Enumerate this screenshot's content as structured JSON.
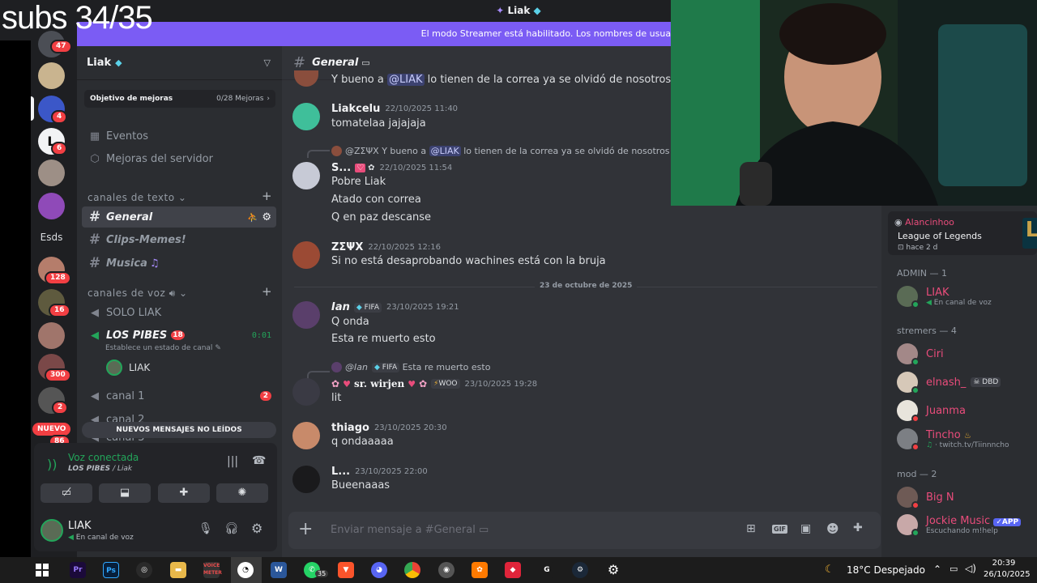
{
  "overlay": {
    "subs": "subs 34/35"
  },
  "window": {
    "title": "Liak"
  },
  "banner": {
    "text": "El modo Streamer está habilitado. Los nombres de usuario se han truncado"
  },
  "servers": {
    "esds_label": "Esds",
    "new_badge": "NUEVO",
    "badges": [
      "47",
      "4",
      "6",
      "128",
      "16",
      "300",
      "2",
      "86"
    ]
  },
  "server": {
    "name": "Liak",
    "boost": {
      "label": "Objetivo de mejoras",
      "progress": "0/28 Mejoras"
    },
    "events": "Eventos",
    "boosts": "Mejoras del servidor"
  },
  "text_category": "canales de texto",
  "text_channels": [
    {
      "name": "General"
    },
    {
      "name": "Clips-Memes!"
    },
    {
      "name": "Musica"
    }
  ],
  "voice_category": "canales de voz",
  "voice_channels": {
    "solo": "SOLO LIAK",
    "pibes": "LOS PIBES",
    "pibes_timer": "0:01",
    "status_hint": "Establece un estado de canal",
    "member": "LIAK",
    "canal1": "canal 1",
    "canal1_badge": "2",
    "canal2": "canal 2",
    "canal3": "canal 3",
    "unread": "NUEVOS MENSAJES NO LEÍDOS"
  },
  "voice_panel": {
    "title": "Voz conectada",
    "subtitle": "LOS PIBES",
    "server": "/ Liak"
  },
  "user": {
    "name": "LIAK",
    "status": "En canal de voz"
  },
  "chat": {
    "channel": "General",
    "top_partial": {
      "pre": "Y bueno a",
      "mention": "@LIAK",
      "post": "lo tienen de la correa ya se olvidó de nosotros"
    },
    "m1": {
      "author": "Liakcelu",
      "time": "22/10/2025 11:40",
      "lines": [
        "tomatelaa jajajaja"
      ]
    },
    "m2": {
      "reply_author": "@ΖΣΨΧ",
      "reply_pre": "Y bueno a",
      "reply_mention": "@LIAK",
      "reply_post": "lo tienen de la correa ya se olvidó de nosotros",
      "author": "S...",
      "time": "22/10/2025 11:54",
      "lines": [
        "Pobre Liak",
        "Atado con correa",
        "Q en paz descanse"
      ]
    },
    "m3": {
      "author": "ΖΣΨΧ",
      "time": "22/10/2025 12:16",
      "lines": [
        "Si no está desaprobando wachines está con la bruja"
      ]
    },
    "divider": "23 de octubre de 2025",
    "m4": {
      "author": "Ian",
      "tag": "FIFA",
      "time": "23/10/2025 19:21",
      "lines": [
        "Q onda",
        "Esta re muerto esto"
      ]
    },
    "m5": {
      "reply_author": "@Ian",
      "reply_tag": "FIFA",
      "reply_text": "Esta re muerto esto",
      "author": "sr. wirjen",
      "tag": "WOO",
      "time": "23/10/2025 19:28",
      "lines": [
        "lit"
      ]
    },
    "m6": {
      "author": "thiago",
      "time": "23/10/2025 20:30",
      "lines": [
        "q ondaaaaa"
      ]
    },
    "m7": {
      "author": "L...",
      "time": "23/10/2025 22:00",
      "lines": [
        "Bueenaaas"
      ]
    },
    "input_placeholder": "Enviar mensaje a #General"
  },
  "members": {
    "top": {
      "name": "Alancinhoo",
      "game": "League of Legends",
      "since": "hace 2 d"
    },
    "admin": {
      "header": "ADMIN — 1",
      "list": [
        {
          "name": "LIAK",
          "sub": "En canal de voz"
        }
      ]
    },
    "streamers": {
      "header": "stremers — 4",
      "list": [
        {
          "name": "Ciri"
        },
        {
          "name": "elnash_",
          "tag": "DBD"
        },
        {
          "name": "Juanma"
        },
        {
          "name": "Tincho",
          "sub": "twitch.tv/Tiinnncho"
        }
      ]
    },
    "mods": {
      "header": "mod — 2",
      "list": [
        {
          "name": "Big N"
        },
        {
          "name": "Jockie Music",
          "tag": "APP",
          "sub": "Escuchando m!help"
        }
      ]
    }
  },
  "taskbar": {
    "weather": "18°C  Despejado",
    "time": "20:39",
    "date": "26/10/2025",
    "whatsapp_badge": "35"
  }
}
